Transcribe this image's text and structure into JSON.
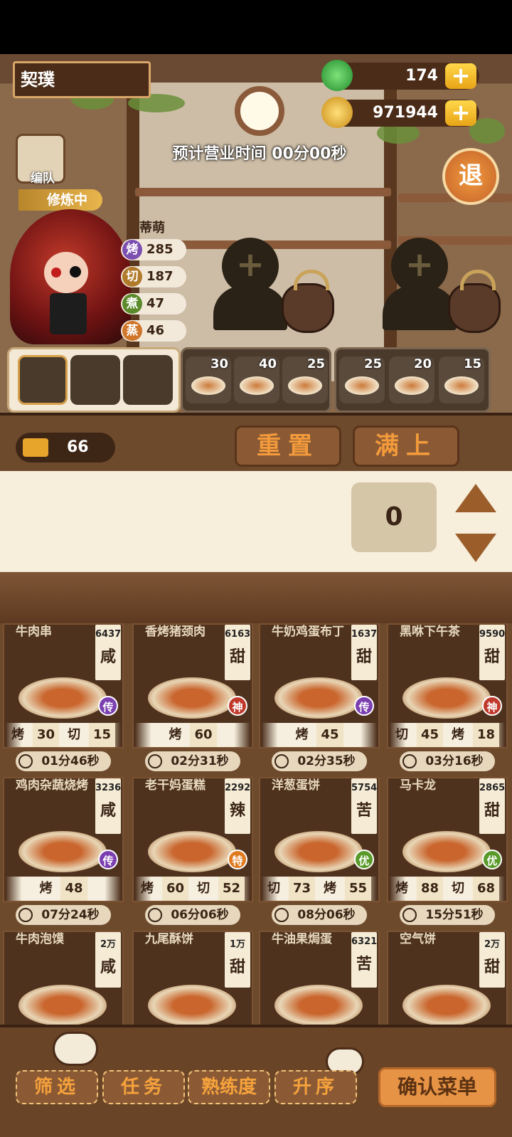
{
  "player": {
    "name": "契璞"
  },
  "currency": {
    "jade": "174",
    "coins": "971944",
    "plus": "+"
  },
  "shift": {
    "label": "预计营业时间 00分00秒"
  },
  "buttons": {
    "exit": "退",
    "team": "编队",
    "reset": "重置",
    "fill": "满上",
    "filter": "筛选",
    "task": "任务",
    "proficiency": "熟练度",
    "sort": "升序",
    "confirm": "确认菜单"
  },
  "chef": {
    "status": "修炼中",
    "name": "蒂萌",
    "stats": [
      {
        "skill": "烤",
        "value": "285",
        "color": "#7b4fb0"
      },
      {
        "skill": "切",
        "value": "187",
        "color": "#b07a2a"
      },
      {
        "skill": "煮",
        "value": "47",
        "color": "#5a8a2a"
      },
      {
        "skill": "蒸",
        "value": "46",
        "color": "#d0762a"
      }
    ]
  },
  "slots": {
    "group1_counts": [
      "30",
      "40",
      "25"
    ],
    "group2_counts": [
      "25",
      "20",
      "15"
    ]
  },
  "ticket": {
    "count": "66"
  },
  "counter": {
    "value": "0"
  },
  "dishes": [
    {
      "name": "牛肉串",
      "price": "6437",
      "flavor": "咸",
      "grade": "传",
      "gradeColor": "#7b3fb0",
      "skills": [
        [
          "烤",
          "30"
        ],
        [
          "切",
          "15"
        ]
      ],
      "time": "01分46秒"
    },
    {
      "name": "香烤猪颈肉",
      "price": "6163",
      "flavor": "甜",
      "grade": "神",
      "gradeColor": "#c0392b",
      "skills": [
        [
          "烤",
          "60"
        ]
      ],
      "time": "02分31秒"
    },
    {
      "name": "牛奶鸡蛋布丁",
      "price": "1637",
      "flavor": "甜",
      "grade": "传",
      "gradeColor": "#7b3fb0",
      "skills": [
        [
          "烤",
          "45"
        ]
      ],
      "time": "02分35秒"
    },
    {
      "name": "黑咻下午茶",
      "price": "9590",
      "flavor": "甜",
      "grade": "神",
      "gradeColor": "#c0392b",
      "skills": [
        [
          "切",
          "45"
        ],
        [
          "烤",
          "18"
        ]
      ],
      "time": "03分16秒"
    },
    {
      "name": "鸡肉杂蔬烧烤",
      "price": "3236",
      "flavor": "咸",
      "grade": "传",
      "gradeColor": "#7b3fb0",
      "skills": [
        [
          "烤",
          "48"
        ]
      ],
      "time": "07分24秒"
    },
    {
      "name": "老干妈蛋糕",
      "price": "2292",
      "flavor": "辣",
      "grade": "特",
      "gradeColor": "#e07b1f",
      "skills": [
        [
          "烤",
          "60"
        ],
        [
          "切",
          "52"
        ]
      ],
      "time": "06分06秒"
    },
    {
      "name": "洋葱蛋饼",
      "price": "5754",
      "flavor": "苦",
      "grade": "优",
      "gradeColor": "#5a9a2a",
      "skills": [
        [
          "切",
          "73"
        ],
        [
          "烤",
          "55"
        ]
      ],
      "time": "08分06秒"
    },
    {
      "name": "马卡龙",
      "price": "2865",
      "flavor": "甜",
      "grade": "优",
      "gradeColor": "#5a9a2a",
      "skills": [
        [
          "烤",
          "88"
        ],
        [
          "切",
          "68"
        ]
      ],
      "time": "15分51秒"
    },
    {
      "name": "牛肉泡馍",
      "price": "2万",
      "flavor": "咸",
      "grade": "",
      "gradeColor": "#7b3fb0",
      "skills": [],
      "time": ""
    },
    {
      "name": "九尾酥饼",
      "price": "1万",
      "flavor": "甜",
      "grade": "",
      "gradeColor": "#7b3fb0",
      "skills": [],
      "time": ""
    },
    {
      "name": "牛油果焗蛋",
      "price": "6321",
      "flavor": "苦",
      "grade": "",
      "gradeColor": "#7b3fb0",
      "skills": [],
      "time": ""
    },
    {
      "name": "空气饼",
      "price": "2万",
      "flavor": "甜",
      "grade": "",
      "gradeColor": "#7b3fb0",
      "skills": [],
      "time": ""
    }
  ]
}
